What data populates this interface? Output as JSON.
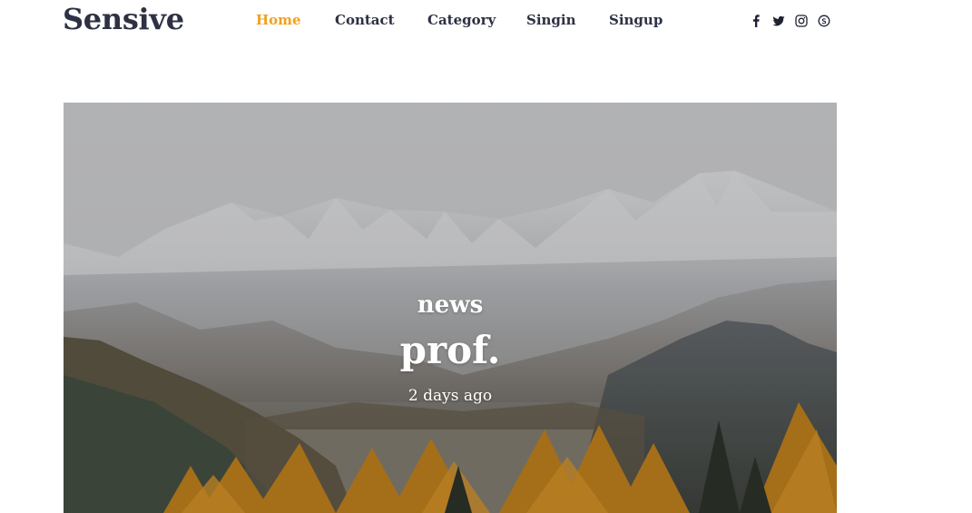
{
  "header": {
    "logo": "Sensive",
    "nav": [
      {
        "label": "Home",
        "active": true
      },
      {
        "label": "Contact",
        "active": false
      },
      {
        "label": "Category",
        "active": false
      },
      {
        "label": "Singin",
        "active": false
      },
      {
        "label": "Singup",
        "active": false
      }
    ],
    "social_icons": [
      "facebook-icon",
      "twitter-icon",
      "instagram-icon",
      "skype-icon"
    ]
  },
  "hero": {
    "category": "news",
    "title": "prof.",
    "date": "2 days ago"
  },
  "colors": {
    "accent": "#f1a01f",
    "text_dark": "#2d3143",
    "hero_text": "#ffffff"
  }
}
